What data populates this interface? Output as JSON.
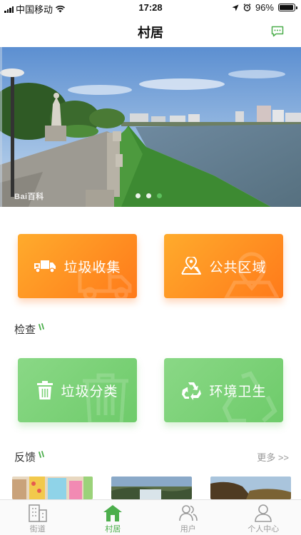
{
  "status_bar": {
    "carrier": "中国移动",
    "time": "17:28",
    "battery": "96%",
    "battery_level": 0.96
  },
  "nav": {
    "title": "村居",
    "message_icon": "message-icon"
  },
  "banner": {
    "watermark": "Bai百科",
    "pages": 3,
    "active_page": 3
  },
  "cards": [
    {
      "label": "垃圾收集",
      "icon": "truck-icon",
      "color": "#ff8c1f"
    },
    {
      "label": "公共区域",
      "icon": "map-pin-icon",
      "color": "#ff8c1f"
    },
    {
      "label": "垃圾分类",
      "icon": "trash-icon",
      "color": "#7bd177"
    },
    {
      "label": "环境卫生",
      "icon": "recycle-icon",
      "color": "#7bd177"
    }
  ],
  "sections": {
    "inspection": "检查",
    "feedback": "反馈",
    "more": "更多 >>"
  },
  "tabs": [
    {
      "label": "街道",
      "icon": "building-icon"
    },
    {
      "label": "村居",
      "icon": "home-icon",
      "active": true
    },
    {
      "label": "用户",
      "icon": "users-icon"
    },
    {
      "label": "个人中心",
      "icon": "person-icon"
    }
  ],
  "colors": {
    "accent_green": "#4cae4c",
    "orange": "#ff8c1f",
    "green_card": "#7bd177"
  }
}
